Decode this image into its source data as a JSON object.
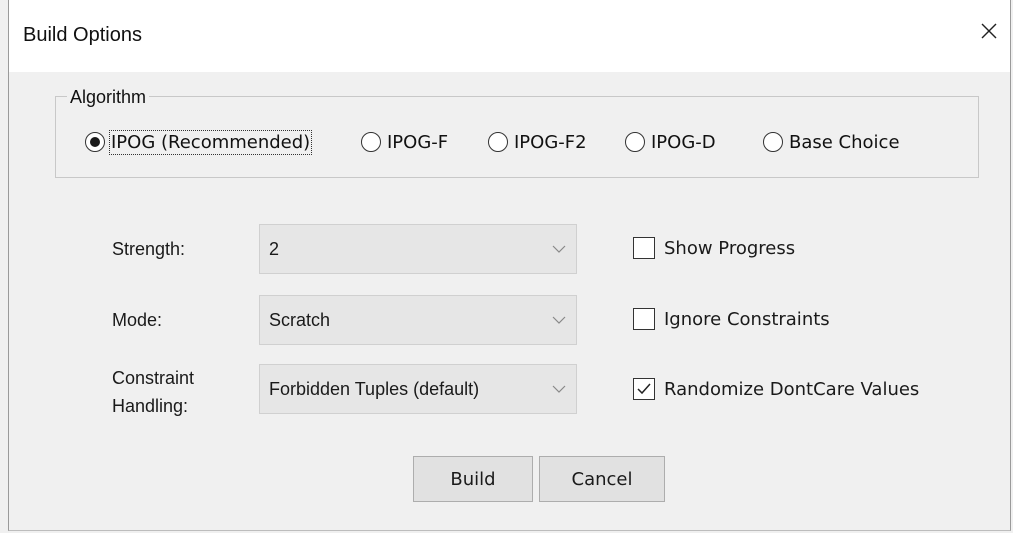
{
  "window": {
    "title": "Build Options",
    "close_icon": "close-icon"
  },
  "algorithm": {
    "group_label": "Algorithm",
    "options": [
      {
        "label": "IPOG (Recommended)",
        "selected": true
      },
      {
        "label": "IPOG-F",
        "selected": false
      },
      {
        "label": "IPOG-F2",
        "selected": false
      },
      {
        "label": "IPOG-D",
        "selected": false
      },
      {
        "label": "Base Choice",
        "selected": false
      }
    ]
  },
  "fields": {
    "strength": {
      "label": "Strength:",
      "value": "2"
    },
    "mode": {
      "label": "Mode:",
      "value": "Scratch"
    },
    "constraint": {
      "label_line1": "Constraint",
      "label_line2": "Handling:",
      "value": "Forbidden Tuples (default)"
    }
  },
  "checkboxes": [
    {
      "label": "Show Progress",
      "checked": false
    },
    {
      "label": "Ignore Constraints",
      "checked": false
    },
    {
      "label": "Randomize DontCare Values",
      "checked": true
    }
  ],
  "buttons": {
    "build": "Build",
    "cancel": "Cancel"
  }
}
